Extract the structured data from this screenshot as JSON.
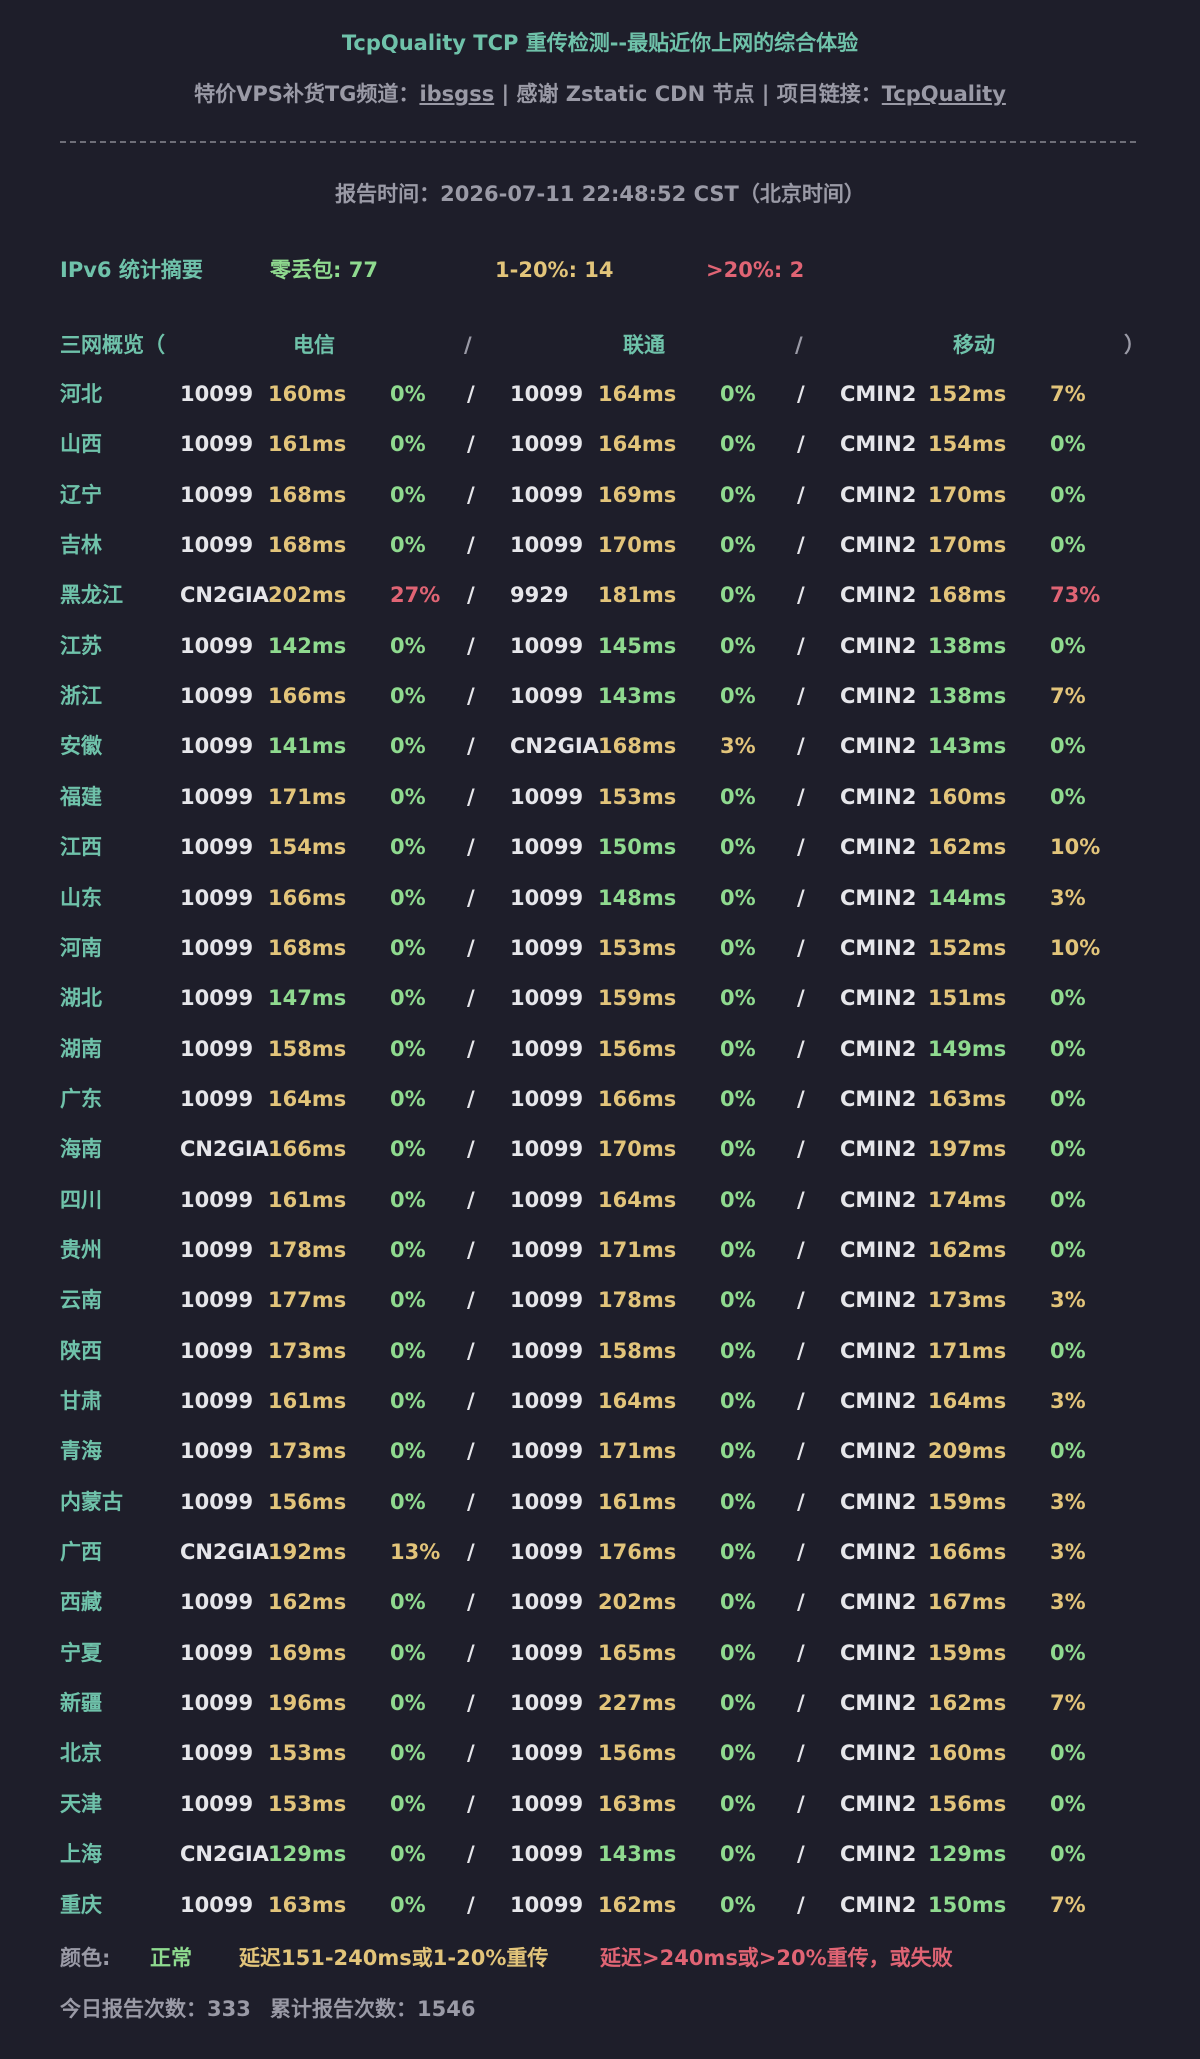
{
  "colors": {
    "background": "#1e1e2a",
    "teal": "#6fc2aa",
    "green": "#8fda8f",
    "yellow": "#e2c47a",
    "red": "#e06474",
    "grey": "#9a9aa6"
  },
  "header": {
    "title": "TcpQuality TCP 重传检测--最贴近你上网的综合体验",
    "sub_prefix": "特价VPS补货TG频道：",
    "sub_link1": "ibsgss",
    "sub_mid": " | 感谢 Zstatic CDN 节点 | 项目链接：",
    "sub_link2": "TcpQuality",
    "divider": "————————————————————————————————————————————————————————————————",
    "report_time": "报告时间：2026-07-11 22:48:52 CST（北京时间）"
  },
  "summary": {
    "label": "IPv6 统计摘要",
    "zero_loss": "零丢包: 77",
    "mid_loss": "1-20%: 14",
    "high_loss": ">20%:  2"
  },
  "table_header": {
    "overview": "三网概览（",
    "telecom": "电信",
    "sep1": "/",
    "unicom": "联通",
    "sep2": "/",
    "mobile": "移动",
    "close": "）"
  },
  "rows": [
    {
      "p": "河北",
      "t": [
        "10099",
        "160ms",
        "y",
        "0%",
        "g"
      ],
      "u": [
        "10099",
        "164ms",
        "y",
        "0%",
        "g"
      ],
      "m": [
        "CMIN2",
        "152ms",
        "y",
        "7%",
        "y"
      ]
    },
    {
      "p": "山西",
      "t": [
        "10099",
        "161ms",
        "y",
        "0%",
        "g"
      ],
      "u": [
        "10099",
        "164ms",
        "y",
        "0%",
        "g"
      ],
      "m": [
        "CMIN2",
        "154ms",
        "y",
        "0%",
        "g"
      ]
    },
    {
      "p": "辽宁",
      "t": [
        "10099",
        "168ms",
        "y",
        "0%",
        "g"
      ],
      "u": [
        "10099",
        "169ms",
        "y",
        "0%",
        "g"
      ],
      "m": [
        "CMIN2",
        "170ms",
        "y",
        "0%",
        "g"
      ]
    },
    {
      "p": "吉林",
      "t": [
        "10099",
        "168ms",
        "y",
        "0%",
        "g"
      ],
      "u": [
        "10099",
        "170ms",
        "y",
        "0%",
        "g"
      ],
      "m": [
        "CMIN2",
        "170ms",
        "y",
        "0%",
        "g"
      ]
    },
    {
      "p": "黑龙江",
      "t": [
        "CN2GIA",
        "202ms",
        "y",
        "27%",
        "r"
      ],
      "u": [
        "9929",
        "181ms",
        "y",
        "0%",
        "g"
      ],
      "m": [
        "CMIN2",
        "168ms",
        "y",
        "73%",
        "r"
      ]
    },
    {
      "p": "江苏",
      "t": [
        "10099",
        "142ms",
        "g",
        "0%",
        "g"
      ],
      "u": [
        "10099",
        "145ms",
        "g",
        "0%",
        "g"
      ],
      "m": [
        "CMIN2",
        "138ms",
        "g",
        "0%",
        "g"
      ]
    },
    {
      "p": "浙江",
      "t": [
        "10099",
        "166ms",
        "y",
        "0%",
        "g"
      ],
      "u": [
        "10099",
        "143ms",
        "g",
        "0%",
        "g"
      ],
      "m": [
        "CMIN2",
        "138ms",
        "g",
        "7%",
        "y"
      ]
    },
    {
      "p": "安徽",
      "t": [
        "10099",
        "141ms",
        "g",
        "0%",
        "g"
      ],
      "u": [
        "CN2GIA",
        "168ms",
        "y",
        "3%",
        "y"
      ],
      "m": [
        "CMIN2",
        "143ms",
        "g",
        "0%",
        "g"
      ]
    },
    {
      "p": "福建",
      "t": [
        "10099",
        "171ms",
        "y",
        "0%",
        "g"
      ],
      "u": [
        "10099",
        "153ms",
        "y",
        "0%",
        "g"
      ],
      "m": [
        "CMIN2",
        "160ms",
        "y",
        "0%",
        "g"
      ]
    },
    {
      "p": "江西",
      "t": [
        "10099",
        "154ms",
        "y",
        "0%",
        "g"
      ],
      "u": [
        "10099",
        "150ms",
        "g",
        "0%",
        "g"
      ],
      "m": [
        "CMIN2",
        "162ms",
        "y",
        "10%",
        "y"
      ]
    },
    {
      "p": "山东",
      "t": [
        "10099",
        "166ms",
        "y",
        "0%",
        "g"
      ],
      "u": [
        "10099",
        "148ms",
        "g",
        "0%",
        "g"
      ],
      "m": [
        "CMIN2",
        "144ms",
        "g",
        "3%",
        "y"
      ]
    },
    {
      "p": "河南",
      "t": [
        "10099",
        "168ms",
        "y",
        "0%",
        "g"
      ],
      "u": [
        "10099",
        "153ms",
        "y",
        "0%",
        "g"
      ],
      "m": [
        "CMIN2",
        "152ms",
        "y",
        "10%",
        "y"
      ]
    },
    {
      "p": "湖北",
      "t": [
        "10099",
        "147ms",
        "g",
        "0%",
        "g"
      ],
      "u": [
        "10099",
        "159ms",
        "y",
        "0%",
        "g"
      ],
      "m": [
        "CMIN2",
        "151ms",
        "y",
        "0%",
        "g"
      ]
    },
    {
      "p": "湖南",
      "t": [
        "10099",
        "158ms",
        "y",
        "0%",
        "g"
      ],
      "u": [
        "10099",
        "156ms",
        "y",
        "0%",
        "g"
      ],
      "m": [
        "CMIN2",
        "149ms",
        "g",
        "0%",
        "g"
      ]
    },
    {
      "p": "广东",
      "t": [
        "10099",
        "164ms",
        "y",
        "0%",
        "g"
      ],
      "u": [
        "10099",
        "166ms",
        "y",
        "0%",
        "g"
      ],
      "m": [
        "CMIN2",
        "163ms",
        "y",
        "0%",
        "g"
      ]
    },
    {
      "p": "海南",
      "t": [
        "CN2GIA",
        "166ms",
        "y",
        "0%",
        "g"
      ],
      "u": [
        "10099",
        "170ms",
        "y",
        "0%",
        "g"
      ],
      "m": [
        "CMIN2",
        "197ms",
        "y",
        "0%",
        "g"
      ]
    },
    {
      "p": "四川",
      "t": [
        "10099",
        "161ms",
        "y",
        "0%",
        "g"
      ],
      "u": [
        "10099",
        "164ms",
        "y",
        "0%",
        "g"
      ],
      "m": [
        "CMIN2",
        "174ms",
        "y",
        "0%",
        "g"
      ]
    },
    {
      "p": "贵州",
      "t": [
        "10099",
        "178ms",
        "y",
        "0%",
        "g"
      ],
      "u": [
        "10099",
        "171ms",
        "y",
        "0%",
        "g"
      ],
      "m": [
        "CMIN2",
        "162ms",
        "y",
        "0%",
        "g"
      ]
    },
    {
      "p": "云南",
      "t": [
        "10099",
        "177ms",
        "y",
        "0%",
        "g"
      ],
      "u": [
        "10099",
        "178ms",
        "y",
        "0%",
        "g"
      ],
      "m": [
        "CMIN2",
        "173ms",
        "y",
        "3%",
        "y"
      ]
    },
    {
      "p": "陕西",
      "t": [
        "10099",
        "173ms",
        "y",
        "0%",
        "g"
      ],
      "u": [
        "10099",
        "158ms",
        "y",
        "0%",
        "g"
      ],
      "m": [
        "CMIN2",
        "171ms",
        "y",
        "0%",
        "g"
      ]
    },
    {
      "p": "甘肃",
      "t": [
        "10099",
        "161ms",
        "y",
        "0%",
        "g"
      ],
      "u": [
        "10099",
        "164ms",
        "y",
        "0%",
        "g"
      ],
      "m": [
        "CMIN2",
        "164ms",
        "y",
        "3%",
        "y"
      ]
    },
    {
      "p": "青海",
      "t": [
        "10099",
        "173ms",
        "y",
        "0%",
        "g"
      ],
      "u": [
        "10099",
        "171ms",
        "y",
        "0%",
        "g"
      ],
      "m": [
        "CMIN2",
        "209ms",
        "y",
        "0%",
        "g"
      ]
    },
    {
      "p": "内蒙古",
      "t": [
        "10099",
        "156ms",
        "y",
        "0%",
        "g"
      ],
      "u": [
        "10099",
        "161ms",
        "y",
        "0%",
        "g"
      ],
      "m": [
        "CMIN2",
        "159ms",
        "y",
        "3%",
        "y"
      ]
    },
    {
      "p": "广西",
      "t": [
        "CN2GIA",
        "192ms",
        "y",
        "13%",
        "y"
      ],
      "u": [
        "10099",
        "176ms",
        "y",
        "0%",
        "g"
      ],
      "m": [
        "CMIN2",
        "166ms",
        "y",
        "3%",
        "y"
      ]
    },
    {
      "p": "西藏",
      "t": [
        "10099",
        "162ms",
        "y",
        "0%",
        "g"
      ],
      "u": [
        "10099",
        "202ms",
        "y",
        "0%",
        "g"
      ],
      "m": [
        "CMIN2",
        "167ms",
        "y",
        "3%",
        "y"
      ]
    },
    {
      "p": "宁夏",
      "t": [
        "10099",
        "169ms",
        "y",
        "0%",
        "g"
      ],
      "u": [
        "10099",
        "165ms",
        "y",
        "0%",
        "g"
      ],
      "m": [
        "CMIN2",
        "159ms",
        "y",
        "0%",
        "g"
      ]
    },
    {
      "p": "新疆",
      "t": [
        "10099",
        "196ms",
        "y",
        "0%",
        "g"
      ],
      "u": [
        "10099",
        "227ms",
        "y",
        "0%",
        "g"
      ],
      "m": [
        "CMIN2",
        "162ms",
        "y",
        "7%",
        "y"
      ]
    },
    {
      "p": "北京",
      "t": [
        "10099",
        "153ms",
        "y",
        "0%",
        "g"
      ],
      "u": [
        "10099",
        "156ms",
        "y",
        "0%",
        "g"
      ],
      "m": [
        "CMIN2",
        "160ms",
        "y",
        "0%",
        "g"
      ]
    },
    {
      "p": "天津",
      "t": [
        "10099",
        "153ms",
        "y",
        "0%",
        "g"
      ],
      "u": [
        "10099",
        "163ms",
        "y",
        "0%",
        "g"
      ],
      "m": [
        "CMIN2",
        "156ms",
        "y",
        "0%",
        "g"
      ]
    },
    {
      "p": "上海",
      "t": [
        "CN2GIA",
        "129ms",
        "g",
        "0%",
        "g"
      ],
      "u": [
        "10099",
        "143ms",
        "g",
        "0%",
        "g"
      ],
      "m": [
        "CMIN2",
        "129ms",
        "g",
        "0%",
        "g"
      ]
    },
    {
      "p": "重庆",
      "t": [
        "10099",
        "163ms",
        "y",
        "0%",
        "g"
      ],
      "u": [
        "10099",
        "162ms",
        "y",
        "0%",
        "g"
      ],
      "m": [
        "CMIN2",
        "150ms",
        "g",
        "7%",
        "y"
      ]
    }
  ],
  "legend": {
    "label": "颜色:",
    "normal": "正常",
    "warn": "延迟151-240ms或1-20%重传",
    "bad": "延迟>240ms或>20%重传，或失败"
  },
  "footer": {
    "today": "今日报告次数：333",
    "total": "累计报告次数：1546"
  }
}
